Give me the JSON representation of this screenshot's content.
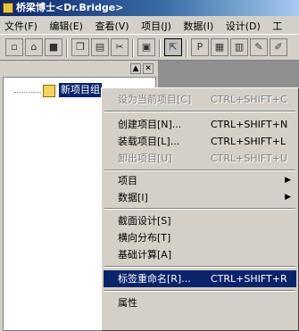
{
  "window": {
    "title": "桥梁博士<Dr.Bridge>"
  },
  "menubar": {
    "items": [
      "文件(F)",
      "编辑(E)",
      "查看(V)",
      "项目(J)",
      "数据(I)",
      "设计(D)",
      "工"
    ]
  },
  "toolbar": {
    "buttons": [
      "new",
      "open",
      "save",
      "copy",
      "paste",
      "cut",
      "print",
      "run",
      "p-tool",
      "grid",
      "pen"
    ]
  },
  "panel": {
    "minimize_label": "▲",
    "close_label": "✕"
  },
  "tree": {
    "selected_item": "新项目组"
  },
  "context_menu": {
    "items": [
      {
        "label": "设为当前项目[C]",
        "shortcut": "CTRL+SHIFT+C",
        "disabled": true
      },
      {
        "label": "创建项目[N]...",
        "shortcut": "CTRL+SHIFT+N",
        "disabled": false
      },
      {
        "label": "装载项目[L]...",
        "shortcut": "CTRL+SHIFT+L",
        "disabled": false
      },
      {
        "label": "卸出项目[U]",
        "shortcut": "CTRL+SHIFT+U",
        "disabled": true
      },
      {
        "label": "项目",
        "submenu": true
      },
      {
        "label": "数据[I]",
        "submenu": true
      },
      {
        "label": "截面设计[S]"
      },
      {
        "label": "横向分布[T]"
      },
      {
        "label": "基础计算[A]"
      },
      {
        "label": "标签重命名[R]...",
        "shortcut": "CTRL+SHIFT+R",
        "highlighted": true
      },
      {
        "label": "属性"
      }
    ],
    "highlight_color": "#0a246a"
  }
}
